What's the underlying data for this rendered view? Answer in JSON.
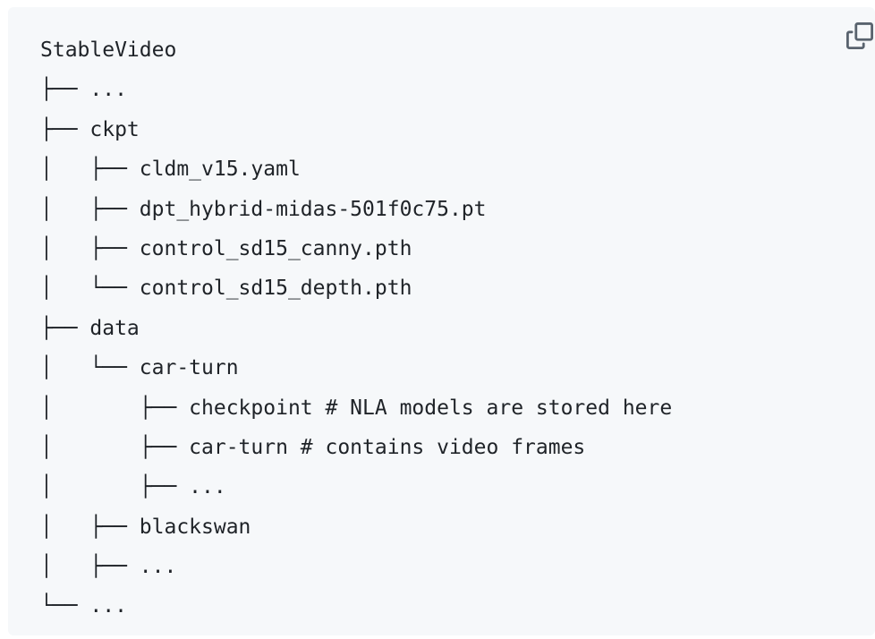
{
  "code_block": {
    "lines": [
      "StableVideo",
      "├── ...",
      "├── ckpt",
      "│   ├── cldm_v15.yaml",
      "│   ├── dpt_hybrid-midas-501f0c75.pt",
      "│   ├── control_sd15_canny.pth",
      "│   └── control_sd15_depth.pth",
      "├── data",
      "│   └── car-turn",
      "│       ├── checkpoint # NLA models are stored here",
      "│       ├── car-turn # contains video frames",
      "│       ├── ...",
      "│   ├── blackswan",
      "│   ├── ...",
      "└── ..."
    ]
  },
  "copy_button": {
    "icon": "copy-icon"
  },
  "colors": {
    "background": "#f6f8fa",
    "text": "#1f2328",
    "icon": "#59636e"
  }
}
